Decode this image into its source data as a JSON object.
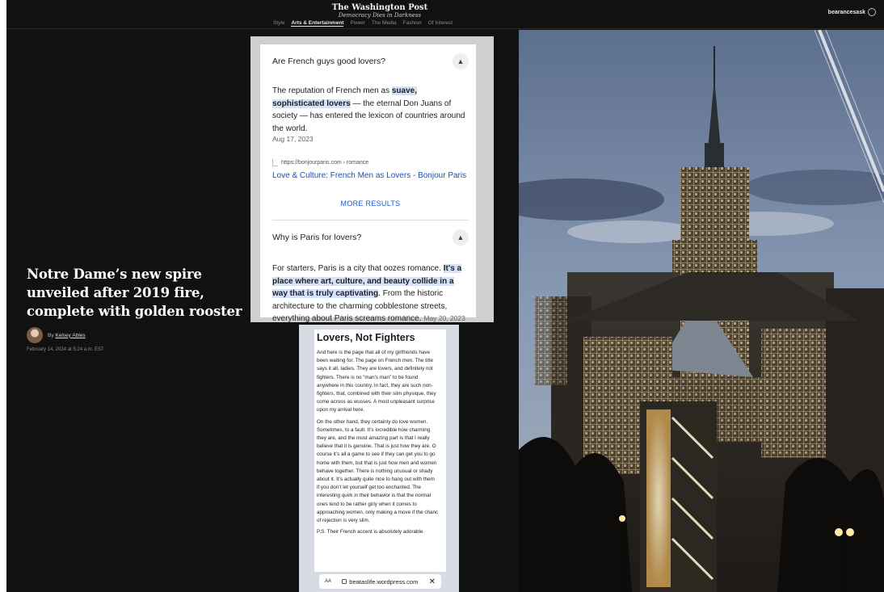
{
  "header": {
    "logo": "The Washington Post",
    "tagline": "Democracy Dies in Darkness",
    "nav": [
      "Style",
      "Arts & Entertainment",
      "Power",
      "The Media",
      "Fashion",
      "Of Interest"
    ],
    "user": "bearancesask"
  },
  "article": {
    "headline": "Notre Dame’s new spire unveiled after 2019 fire, complete with golden rooster",
    "by_prefix": "By",
    "author": "Kelsey Ables",
    "date": "February 14, 2024 at 5:24 a.m. EST"
  },
  "google": {
    "q1": "Are French guys good lovers?",
    "a1_pre": "The reputation of French men as ",
    "a1_hl": "suave, sophisticated lovers",
    "a1_post": " — the eternal Don Juans of society — has entered the lexicon of countries around the world.",
    "a1_date": "Aug 17, 2023",
    "source": "https://bonjourparis.com › romance",
    "link": "Love & Culture: French Men as Lovers - Bonjour Paris",
    "more": "MORE RESULTS",
    "q2": "Why is Paris for lovers?",
    "a2_pre": "For starters, Paris is a city that oozes romance. ",
    "a2_hl": "It's a place where art, culture, and beauty collide in a way that is truly captivating",
    "a2_post": ". From the historic architecture to the charming cobblestone streets, everything about Paris screams romance.",
    "a2_date": "May 20, 2023"
  },
  "blog": {
    "title": "Lovers, Not Fighters",
    "p1": "And here is the page that all of my girlfriends have\nbeen waiting for. The page on French men. The title\nsays it all, ladies. They are lovers, and definitely not\nfighters.  There is no “man’s man” to be found\nanywhere in this country.  In fact, they are such non-\nfighters, that, combined with their slim physique, they\ncome across as wusses. A most unpleasant surprise\nupon my arrival here.",
    "p2": "On the other hand, they certainly do love women.\nSometimes, to a fault.  It’s incredible how charming\nthey are, and the most amazing part is that I really\nbelieve that it is genuine.  That is just how they are.  O\ncourse it’s all a game to see if they can get you to go\nhome with them, but that is just how men and women\nbehave together.  There is nothing unusual or shady\nabout it.  It’s actually quite nice to hang out with them\nif you don’t let yourself get too enchanted.  The\ninteresting quirk in their behavior is that the normal\nones tend to be rather girly when it comes to\napproaching women, only making a move if the chanc\nof rejection is very slim.",
    "p3": "P.S.  Their French accent is absolutely adorable.",
    "aa": "AA",
    "url": "beataslife.wordpress.com",
    "close": "✕"
  },
  "icons": [
    "user-icon",
    "chevron-up-icon",
    "lock-icon",
    "close-icon",
    "source-favicon-icon"
  ],
  "colors": {
    "page_bg": "#111111",
    "highlight": "#d3e3fd",
    "link_blue": "#1a4fb6"
  }
}
